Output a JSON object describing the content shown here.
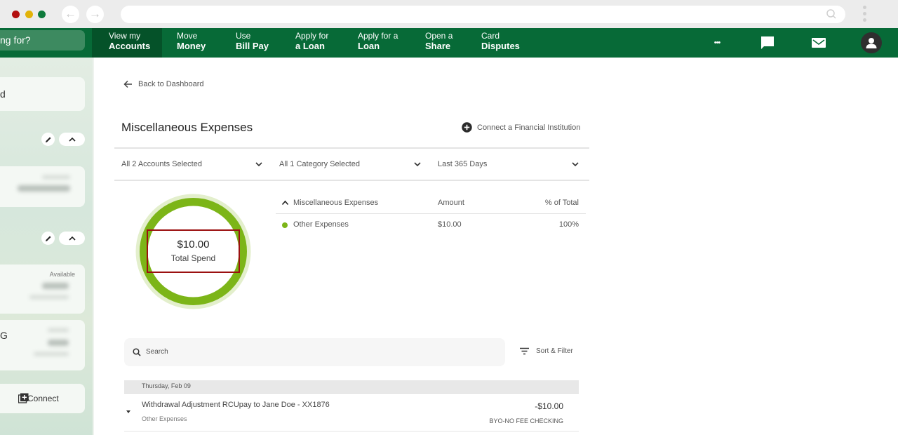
{
  "browser": {
    "back_glyph": "←",
    "forward_glyph": "→",
    "url": ""
  },
  "topnav": {
    "search_placeholder": "ng for?",
    "items": [
      {
        "line1": "View my",
        "line2": "Accounts",
        "active": true
      },
      {
        "line1": "Move",
        "line2": "Money"
      },
      {
        "line1": "Use",
        "line2": "Bill Pay"
      },
      {
        "line1": "Apply for",
        "line2": "a Loan"
      },
      {
        "line1": "Apply for a",
        "line2": "Loan"
      },
      {
        "line1": "Open a",
        "line2": "Share"
      },
      {
        "line1": "Card",
        "line2": "Disputes"
      }
    ],
    "more_glyph": "•••",
    "icons": [
      "more-icon",
      "chat-icon",
      "mail-icon",
      "profile-icon"
    ]
  },
  "sidebar": {
    "card1_text": "d",
    "card4_text": "G",
    "available_label": "Available",
    "connect_label": "Connect"
  },
  "main": {
    "back_label": "Back to Dashboard",
    "title": "Miscellaneous Expenses",
    "connect_fi_label": "Connect a Financial Institution",
    "filters": {
      "accounts": "All 2 Accounts Selected",
      "categories": "All 1 Category Selected",
      "period": "Last 365 Days"
    },
    "summary": {
      "total_amount": "$10.00",
      "total_label": "Total Spend"
    },
    "breakdown": {
      "header_category": "Miscellaneous Expenses",
      "header_amount": "Amount",
      "header_pct": "% of Total",
      "rows": [
        {
          "category": "Other Expenses",
          "amount": "$10.00",
          "pct": "100%",
          "share": 1.0,
          "color": "#7cb518"
        }
      ]
    },
    "search_placeholder": "Search",
    "sort_filter_label": "Sort & Filter",
    "transactions": [
      {
        "date": "Thursday, Feb 09",
        "description": "Withdrawal Adjustment RCUpay to Jane Doe - XX1876",
        "category": "Other Expenses",
        "amount": "-$10.00",
        "account": "BYO-NO FEE CHECKING"
      }
    ]
  },
  "colors": {
    "nav_green": "#076a37",
    "nav_active": "#055229",
    "donut_green": "#7cb518",
    "donut_halo": "#e3efcc",
    "callout_red": "#9b1010"
  }
}
